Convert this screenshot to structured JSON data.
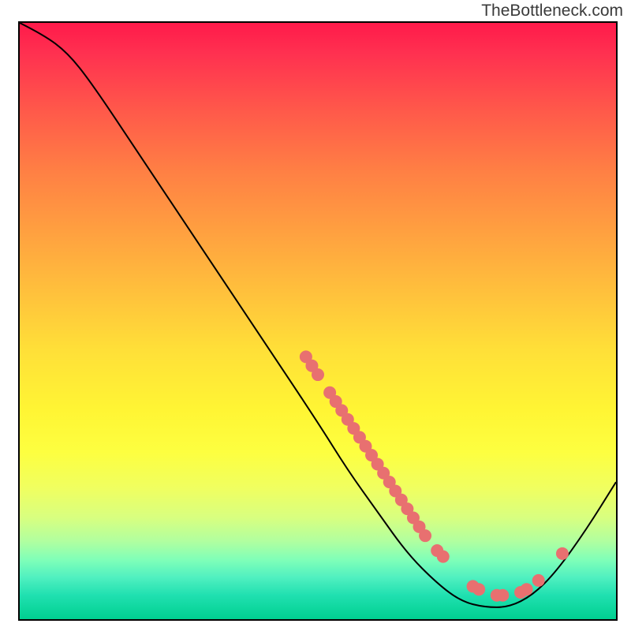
{
  "watermark": "TheBottleneck.com",
  "chart_data": {
    "type": "line",
    "title": "",
    "xlabel": "",
    "ylabel": "",
    "x_range": [
      0,
      100
    ],
    "y_range": [
      0,
      100
    ],
    "curve": [
      {
        "x": 0,
        "y": 100
      },
      {
        "x": 4,
        "y": 98
      },
      {
        "x": 8,
        "y": 95
      },
      {
        "x": 12,
        "y": 90
      },
      {
        "x": 20,
        "y": 78
      },
      {
        "x": 30,
        "y": 63
      },
      {
        "x": 40,
        "y": 48
      },
      {
        "x": 50,
        "y": 33
      },
      {
        "x": 55,
        "y": 25
      },
      {
        "x": 60,
        "y": 18
      },
      {
        "x": 65,
        "y": 11
      },
      {
        "x": 70,
        "y": 6
      },
      {
        "x": 74,
        "y": 3
      },
      {
        "x": 78,
        "y": 2
      },
      {
        "x": 82,
        "y": 2
      },
      {
        "x": 86,
        "y": 4
      },
      {
        "x": 90,
        "y": 8
      },
      {
        "x": 95,
        "y": 15
      },
      {
        "x": 100,
        "y": 23
      }
    ],
    "markers": [
      {
        "x": 48,
        "y": 44
      },
      {
        "x": 49,
        "y": 42.5
      },
      {
        "x": 50,
        "y": 41
      },
      {
        "x": 52,
        "y": 38
      },
      {
        "x": 53,
        "y": 36.5
      },
      {
        "x": 54,
        "y": 35
      },
      {
        "x": 55,
        "y": 33.5
      },
      {
        "x": 56,
        "y": 32
      },
      {
        "x": 57,
        "y": 30.5
      },
      {
        "x": 58,
        "y": 29
      },
      {
        "x": 59,
        "y": 27.5
      },
      {
        "x": 60,
        "y": 26
      },
      {
        "x": 61,
        "y": 24.5
      },
      {
        "x": 62,
        "y": 23
      },
      {
        "x": 63,
        "y": 21.5
      },
      {
        "x": 64,
        "y": 20
      },
      {
        "x": 65,
        "y": 18.5
      },
      {
        "x": 66,
        "y": 17
      },
      {
        "x": 67,
        "y": 15.5
      },
      {
        "x": 68,
        "y": 14
      },
      {
        "x": 70,
        "y": 11.5
      },
      {
        "x": 71,
        "y": 10.5
      },
      {
        "x": 76,
        "y": 5.5
      },
      {
        "x": 77,
        "y": 5
      },
      {
        "x": 80,
        "y": 4
      },
      {
        "x": 81,
        "y": 4
      },
      {
        "x": 84,
        "y": 4.5
      },
      {
        "x": 85,
        "y": 5
      },
      {
        "x": 87,
        "y": 6.5
      },
      {
        "x": 91,
        "y": 11
      }
    ],
    "marker_color": "#e87070",
    "marker_radius": 8
  }
}
